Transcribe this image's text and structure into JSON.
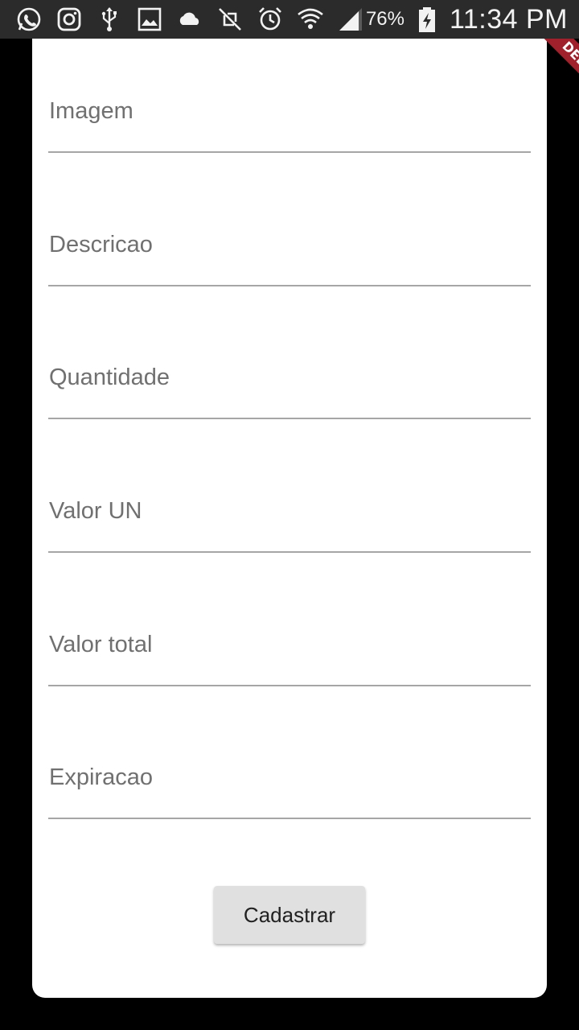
{
  "status_bar": {
    "icons_left": [
      "whatsapp-icon",
      "instagram-icon",
      "usb-icon",
      "gallery-icon",
      "cloud-icon",
      "vibrate-off-icon",
      "alarm-icon",
      "wifi-icon",
      "signal-icon"
    ],
    "battery_percent": "76%",
    "time": "11:34 PM"
  },
  "debug_banner": {
    "label": "DEBUG"
  },
  "form": {
    "fields": [
      {
        "label": "Imagem",
        "value": ""
      },
      {
        "label": "Descricao",
        "value": ""
      },
      {
        "label": "Quantidade",
        "value": ""
      },
      {
        "label": "Valor UN",
        "value": ""
      },
      {
        "label": "Valor total",
        "value": ""
      },
      {
        "label": "Expiracao",
        "value": ""
      }
    ],
    "submit_label": "Cadastrar"
  },
  "colors": {
    "background": "#000000",
    "card": "#ffffff",
    "label_text": "#707070",
    "underline": "#a6a6a6",
    "button_bg": "#e0e0e0",
    "debug_ribbon": "#a0212b"
  }
}
